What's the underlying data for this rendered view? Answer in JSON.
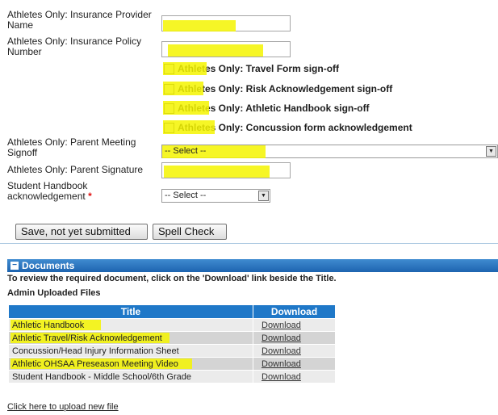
{
  "form": {
    "insurance_provider_label": "Athletes Only: Insurance Provider Name",
    "insurance_policy_label": "Athletes Only: Insurance Policy Number",
    "checkboxes": [
      "Athletes Only: Travel Form sign-off",
      "Athletes Only: Risk Acknowledgement sign-off",
      "Athletes Only: Athletic Handbook sign-off",
      "Athletes Only: Concussion form acknowledgement"
    ],
    "parent_meeting_label": "Athletes Only: Parent Meeting Signoff",
    "parent_meeting_value": "-- Select --",
    "parent_signature_label": "Athletes Only: Parent Signature",
    "student_handbook_label": "Student Handbook acknowledgement",
    "required_mark": "*",
    "student_handbook_value": "-- Select --",
    "save_button": "Save, not yet submitted",
    "spell_check_button": "Spell Check"
  },
  "documents": {
    "header": "Documents",
    "instruction": "To review the required document, click on the 'Download' link beside the Title.",
    "admin_files_label": "Admin Uploaded Files",
    "columns": [
      "Title",
      "Download"
    ],
    "rows": [
      {
        "title": "Athletic Handbook",
        "download": "Download"
      },
      {
        "title": "Athletic Travel/Risk Acknowledgement",
        "download": "Download"
      },
      {
        "title": "Concussion/Head Injury Information Sheet",
        "download": "Download"
      },
      {
        "title": "Athletic OHSAA Preseason Meeting Video",
        "download": "Download"
      },
      {
        "title": "Student Handbook - Middle School/6th Grade",
        "download": "Download"
      }
    ],
    "upload_link": "Click here to upload new file"
  },
  "colors": {
    "highlight": "#f4f400",
    "header_blue": "#1e64b0",
    "required_red": "#e01010"
  }
}
